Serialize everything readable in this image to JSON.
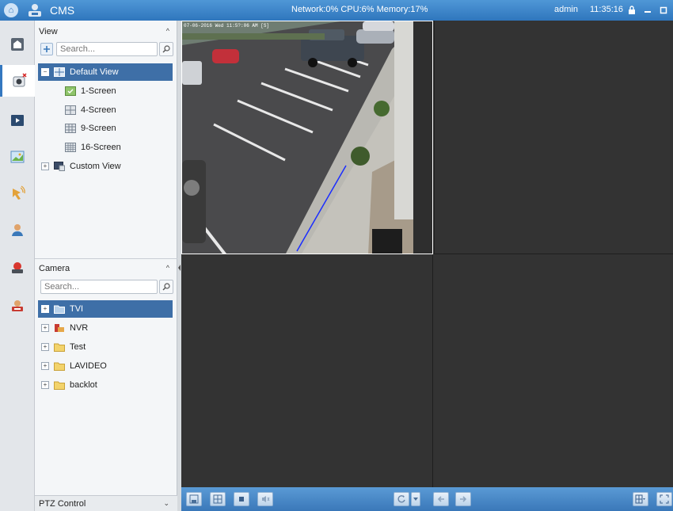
{
  "app": {
    "title": "CMS",
    "status": "Network:0%  CPU:6%  Memory:17%",
    "user": "admin",
    "time": "11:35:16"
  },
  "view_panel": {
    "header": "View",
    "search_placeholder": "Search...",
    "items": [
      {
        "label": "Default View"
      },
      {
        "label": "1-Screen"
      },
      {
        "label": "4-Screen"
      },
      {
        "label": "9-Screen"
      },
      {
        "label": "16-Screen"
      },
      {
        "label": "Custom View"
      }
    ]
  },
  "camera_panel": {
    "header": "Camera",
    "search_placeholder": "Search...",
    "items": [
      {
        "label": "TVI"
      },
      {
        "label": "NVR"
      },
      {
        "label": "Test"
      },
      {
        "label": "LAVIDEO"
      },
      {
        "label": "backlot"
      }
    ]
  },
  "ptz": {
    "label": "PTZ Control"
  },
  "video": {
    "osd": "07-06-2016 Wed 11:5?:06 AM [S]"
  },
  "colors": {
    "titlebar": "#3a82c7",
    "selection": "#3e6fa7",
    "panel_bg": "#f4f6f8",
    "video_bg": "#333333",
    "toolbar": "#4a89c8"
  }
}
